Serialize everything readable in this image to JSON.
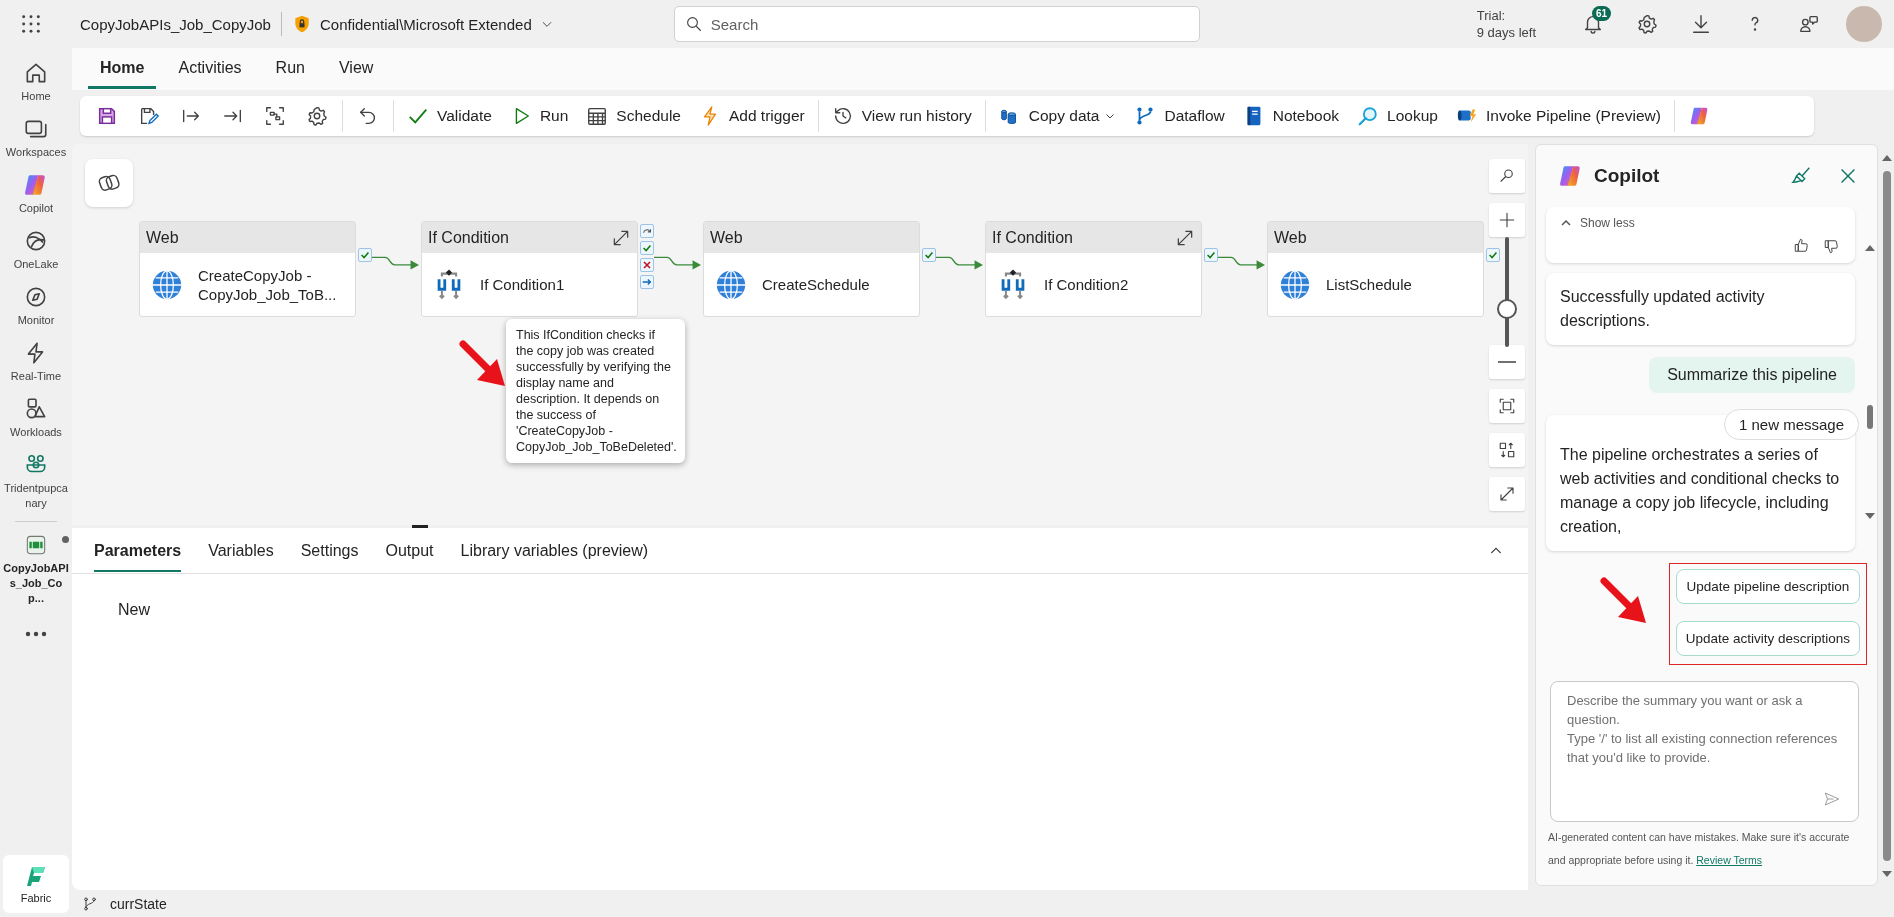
{
  "app_bar": {
    "title": "CopyJobAPIs_Job_CopyJob",
    "sensitivity": "Confidential\\Microsoft Extended",
    "search": {
      "placeholder": "Search"
    },
    "trial": [
      "Trial:",
      "9 days left"
    ],
    "notifications": "61"
  },
  "left_rail": {
    "items": [
      {
        "label": "Home"
      },
      {
        "label": "Workspaces"
      },
      {
        "label": "Copilot"
      },
      {
        "label": "OneLake"
      },
      {
        "label": "Monitor"
      },
      {
        "label": "Real-Time"
      },
      {
        "label": "Workloads"
      },
      {
        "label": "Tridentpupcanary"
      }
    ],
    "open_item": {
      "label": "CopyJobAPIs_Job_Cop...",
      "modified": true
    },
    "footer": "Fabric"
  },
  "ribbon": {
    "tabs": [
      {
        "label": "Home",
        "selected": true
      },
      {
        "label": "Activities",
        "selected": false
      },
      {
        "label": "Run",
        "selected": false
      },
      {
        "label": "View",
        "selected": false
      }
    ],
    "toolbar": [
      {
        "kind": "icon"
      },
      {
        "kind": "icon"
      },
      {
        "kind": "icon"
      },
      {
        "kind": "icon"
      },
      {
        "kind": "icon"
      },
      {
        "kind": "icon"
      },
      {
        "kind": "divider"
      },
      {
        "kind": "icon"
      },
      {
        "kind": "divider"
      },
      {
        "kind": "button",
        "label": "Validate"
      },
      {
        "kind": "button",
        "label": "Run"
      },
      {
        "kind": "button",
        "label": "Schedule"
      },
      {
        "kind": "button",
        "label": "Add trigger"
      },
      {
        "kind": "divider"
      },
      {
        "kind": "button",
        "label": "View run history"
      },
      {
        "kind": "divider"
      },
      {
        "kind": "dropdown",
        "label": "Copy data"
      },
      {
        "kind": "button",
        "label": "Dataflow"
      },
      {
        "kind": "button",
        "label": "Notebook"
      },
      {
        "kind": "button",
        "label": "Lookup"
      },
      {
        "kind": "button",
        "label": "Invoke Pipeline (Preview)"
      },
      {
        "kind": "divider"
      },
      {
        "kind": "icon"
      }
    ]
  },
  "canvas": {
    "activities": [
      {
        "type": "Web",
        "name": "CreateCopyJob - CopyJob_Job_ToB...",
        "kind": "web",
        "expandable": false,
        "ports": [
          {
            "kind": "success"
          }
        ]
      },
      {
        "type": "If Condition",
        "name": "If Condition1",
        "kind": "if",
        "expandable": true,
        "ports": [
          {
            "kind": "skip"
          },
          {
            "kind": "success"
          },
          {
            "kind": "fail"
          },
          {
            "kind": "complete"
          }
        ]
      },
      {
        "type": "Web",
        "name": "CreateSchedule",
        "kind": "web",
        "expandable": false,
        "ports": [
          {
            "kind": "success"
          }
        ]
      },
      {
        "type": "If Condition",
        "name": "If Condition2",
        "kind": "if",
        "expandable": true,
        "ports": [
          {
            "kind": "success"
          }
        ]
      },
      {
        "type": "Web",
        "name": "ListSchedule",
        "kind": "web",
        "expandable": false,
        "ports": [
          {
            "kind": "success"
          }
        ]
      }
    ],
    "tooltip": "This IfCondition checks if the copy job was created successfully by verifying the display name and description. It depends on the success of 'CreateCopyJob - CopyJob_Job_ToBeDeleted'.",
    "zoom": {
      "level": 0.35
    }
  },
  "bottom_panel": {
    "tabs": [
      {
        "label": "Parameters",
        "selected": true
      },
      {
        "label": "Variables",
        "selected": false
      },
      {
        "label": "Settings",
        "selected": false
      },
      {
        "label": "Output",
        "selected": false
      },
      {
        "label": "Library variables (preview)",
        "selected": false
      }
    ],
    "new_button": "New"
  },
  "copilot": {
    "title": "Copilot",
    "messages": [
      {
        "kind": "feedback",
        "text": "Show less"
      },
      {
        "kind": "assistant",
        "text": "Successfully updated activity descriptions."
      },
      {
        "kind": "user",
        "text": "Summarize this pipeline"
      },
      {
        "kind": "assistant",
        "text": "The pipeline orchestrates a series of web activities and conditional checks to manage a copy job lifecycle, including creation,"
      }
    ],
    "new_message": "1 new message",
    "suggestions": [
      "Update pipeline description",
      "Update activity descriptions"
    ],
    "input": {
      "placeholder": "Describe the summary you want or ask a question.\nType '/' to list all existing connection references that you'd like to provide."
    },
    "disclaimer": "AI-generated content can have mistakes. Make sure it's accurate and appropriate before using it.",
    "review_link": "Review Terms"
  },
  "status_bar": {
    "branch": "currState"
  }
}
